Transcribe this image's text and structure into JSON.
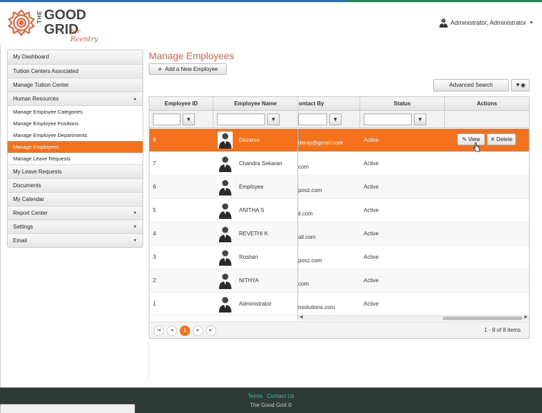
{
  "header": {
    "logo": {
      "the": "THE",
      "good": "GOOD",
      "grid": "GRID",
      "tagline": "for Reentry"
    },
    "user_label": "Administrator, Administrator"
  },
  "sidebar": {
    "items": [
      {
        "label": "My Dashboard"
      },
      {
        "label": "Tuition Centers Associated"
      },
      {
        "label": "Manage Tuition Center"
      },
      {
        "label": "Human Resources"
      },
      {
        "label": "My Leave Requests"
      },
      {
        "label": "Documents"
      },
      {
        "label": "My Calendar"
      },
      {
        "label": "Report Center"
      },
      {
        "label": "Settings"
      },
      {
        "label": "Email"
      }
    ],
    "sub_items": [
      {
        "label": "Manage Employee Categories"
      },
      {
        "label": "Manage Employee Positions"
      },
      {
        "label": "Manage Employee Departments"
      },
      {
        "label": "Manage Employees",
        "active": true
      },
      {
        "label": "Manage Leave Requests"
      }
    ]
  },
  "main": {
    "title": "Manage Employees",
    "add_button": "Add a New Employee",
    "advanced_search": "Advanced Search",
    "columns": [
      "Employee ID",
      "Employee Name",
      "ontact By",
      "Status",
      "Actions"
    ],
    "rows": [
      {
        "id": "8",
        "name": "Dezaree",
        "contact": "deray@gmail.com",
        "status": "Active",
        "selected": true
      },
      {
        "id": "7",
        "name": "Chandra Sekaran",
        "contact": "com",
        "status": "Active"
      },
      {
        "id": "6",
        "name": "Employee",
        "contact": "poxz.com",
        "status": "Active"
      },
      {
        "id": "5",
        "name": "ANITHA S",
        "contact": "il.com",
        "status": "Active"
      },
      {
        "id": "4",
        "name": "REVETHI K",
        "contact": "ail.com",
        "status": "Active"
      },
      {
        "id": "3",
        "name": "Roshan",
        "contact": "poxz.com",
        "status": "Active"
      },
      {
        "id": "2",
        "name": "NITHYA",
        "contact": "com",
        "status": "Active"
      },
      {
        "id": "1",
        "name": "Administrator",
        "contact": "nsolutions.com",
        "status": "Active"
      }
    ],
    "view_button": "View",
    "delete_button": "Delete",
    "pager": {
      "current_page": "1",
      "info": "1 - 8 of 8 items"
    }
  },
  "footer": {
    "terms": "Terms",
    "contact": "Contact Us",
    "copyright": "The Good Grid ©"
  },
  "colors": {
    "accent": "#f5711c",
    "title": "#e8603c",
    "footer_bg": "#2e3a36",
    "footer_link": "#3fc1a8"
  }
}
